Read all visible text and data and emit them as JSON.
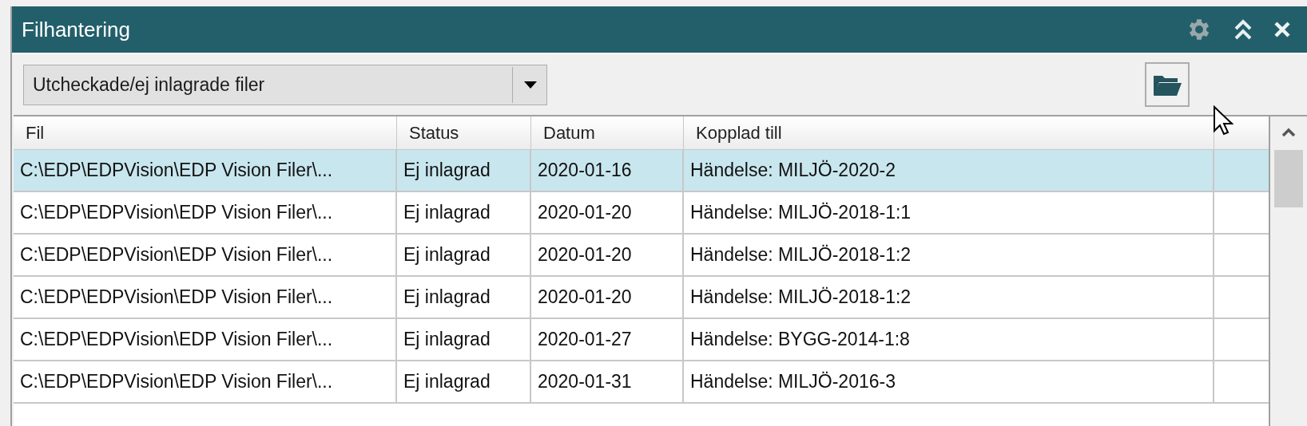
{
  "window": {
    "title": "Filhantering"
  },
  "filter": {
    "value": "Utcheckade/ej inlagrade filer"
  },
  "table": {
    "columns": [
      "Fil",
      "Status",
      "Datum",
      "Kopplad till"
    ],
    "rows": [
      {
        "selected": true,
        "cells": [
          "C:\\EDP\\EDPVision\\EDP Vision Filer\\...",
          "Ej inlagrad",
          "2020-01-16",
          "Händelse: MILJÖ-2020-2"
        ]
      },
      {
        "selected": false,
        "cells": [
          "C:\\EDP\\EDPVision\\EDP Vision Filer\\...",
          "Ej inlagrad",
          "2020-01-20",
          "Händelse: MILJÖ-2018-1:1"
        ]
      },
      {
        "selected": false,
        "cells": [
          "C:\\EDP\\EDPVision\\EDP Vision Filer\\...",
          "Ej inlagrad",
          "2020-01-20",
          "Händelse: MILJÖ-2018-1:2"
        ]
      },
      {
        "selected": false,
        "cells": [
          "C:\\EDP\\EDPVision\\EDP Vision Filer\\...",
          "Ej inlagrad",
          "2020-01-20",
          "Händelse: MILJÖ-2018-1:2"
        ]
      },
      {
        "selected": false,
        "cells": [
          "C:\\EDP\\EDPVision\\EDP Vision Filer\\...",
          "Ej inlagrad",
          "2020-01-27",
          "Händelse: BYGG-2014-1:8"
        ]
      },
      {
        "selected": false,
        "cells": [
          "C:\\EDP\\EDPVision\\EDP Vision Filer\\...",
          "Ej inlagrad",
          "2020-01-31",
          "Händelse: MILJÖ-2016-3"
        ]
      }
    ]
  }
}
